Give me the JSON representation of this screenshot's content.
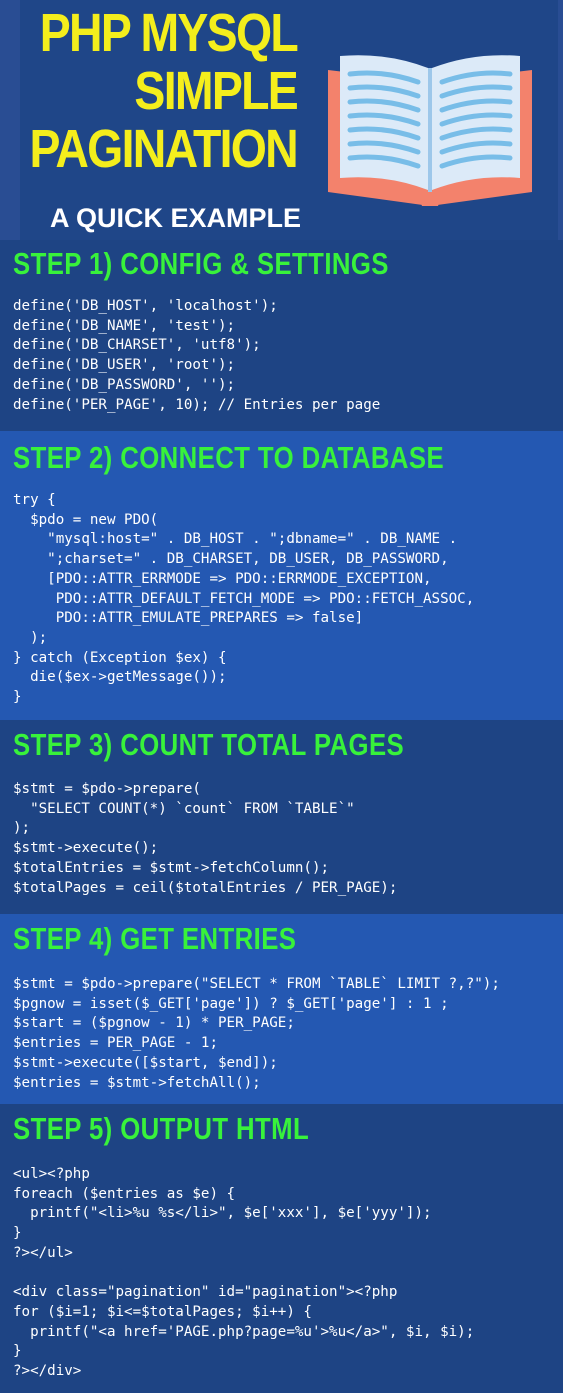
{
  "header": {
    "title_lines": [
      "PHP MYSQL",
      "SIMPLE",
      "PAGINATION"
    ],
    "subtitle": "A QUICK EXAMPLE",
    "icon": "open-book-icon"
  },
  "colors": {
    "title": "#f4ee1c",
    "step_heading": "#38f23b",
    "dark_panel": "#1e4484",
    "light_panel": "#2458b2",
    "book_cover": "#f3826c",
    "book_pages": "#dceaf8",
    "book_lines": "#78bde8"
  },
  "sections": [
    {
      "heading": "STEP 1) CONFIG & SETTINGS",
      "code": "define('DB_HOST', 'localhost');\ndefine('DB_NAME', 'test');\ndefine('DB_CHARSET', 'utf8');\ndefine('DB_USER', 'root');\ndefine('DB_PASSWORD', '');\ndefine('PER_PAGE', 10); // Entries per page"
    },
    {
      "heading": "STEP 2) CONNECT TO DATABASE",
      "code": "try {\n  $pdo = new PDO(\n    \"mysql:host=\" . DB_HOST . \";dbname=\" . DB_NAME .\n    \";charset=\" . DB_CHARSET, DB_USER, DB_PASSWORD,\n    [PDO::ATTR_ERRMODE => PDO::ERRMODE_EXCEPTION,\n     PDO::ATTR_DEFAULT_FETCH_MODE => PDO::FETCH_ASSOC,\n     PDO::ATTR_EMULATE_PREPARES => false]\n  );\n} catch (Exception $ex) {\n  die($ex->getMessage());\n}"
    },
    {
      "heading": "STEP 3) COUNT TOTAL PAGES",
      "code": "$stmt = $pdo->prepare(\n  \"SELECT COUNT(*) `count` FROM `TABLE`\"\n);\n$stmt->execute();\n$totalEntries = $stmt->fetchColumn();\n$totalPages = ceil($totalEntries / PER_PAGE);"
    },
    {
      "heading": "STEP 4) GET ENTRIES",
      "code": "$stmt = $pdo->prepare(\"SELECT * FROM `TABLE` LIMIT ?,?\");\n$pgnow = isset($_GET['page']) ? $_GET['page'] : 1 ;\n$start = ($pgnow - 1) * PER_PAGE;\n$entries = PER_PAGE - 1;\n$stmt->execute([$start, $end]);\n$entries = $stmt->fetchAll();"
    },
    {
      "heading": "STEP 5) OUTPUT HTML",
      "code": "<ul><?php\nforeach ($entries as $e) {\n  printf(\"<li>%u %s</li>\", $e['xxx'], $e['yyy']);\n}\n?></ul>\n\n<div class=\"pagination\" id=\"pagination\"><?php\nfor ($i=1; $i<=$totalPages; $i++) {\n  printf(\"<a href='PAGE.php?page=%u'>%u</a>\", $i, $i);\n}\n?></div>"
    }
  ]
}
